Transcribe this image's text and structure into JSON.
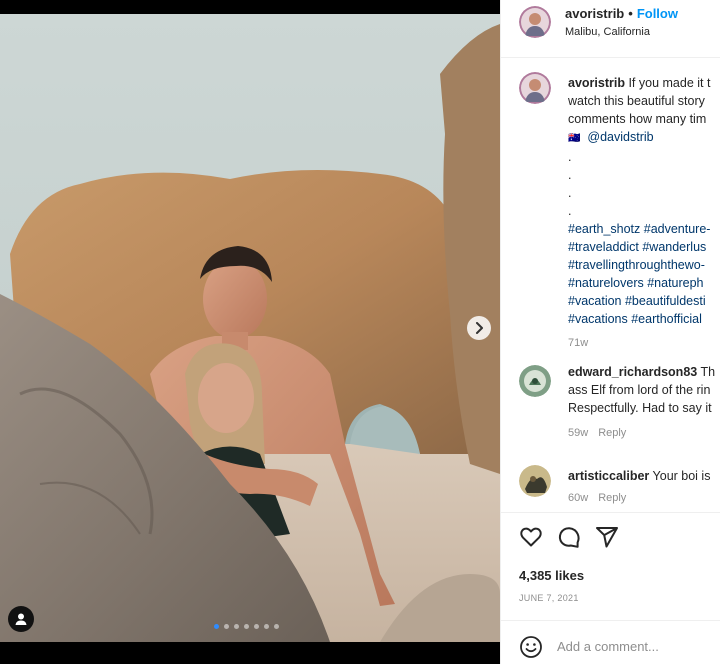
{
  "post": {
    "photo_alt": "Couple posing between rocks on a beach",
    "carousel": {
      "count": 7,
      "active_index": 0
    }
  },
  "header": {
    "username": "avoristrib",
    "separator": "•",
    "follow_label": "Follow",
    "location": "Malibu, California"
  },
  "caption": {
    "username": "avoristrib",
    "lines": [
      "If you made it t",
      "watch this beautiful story",
      "comments how many tim"
    ],
    "flag": "🇦🇺",
    "mention": "@davidstrib",
    "dots": [
      ".",
      ".",
      ".",
      "."
    ],
    "hashtag_lines": [
      "#earth_shotz #adventure-",
      "#traveladdict #wanderlus",
      "#travellingthroughthewo-",
      "#naturelovers #natureph",
      "#vacation #beautifuldesti",
      "#vacations #earthofficial"
    ],
    "age": "71w"
  },
  "comments": [
    {
      "username": "edward_richardson83",
      "text_first": "Th",
      "lines": [
        "ass Elf from lord of the rin",
        "Respectfully. Had to say it"
      ],
      "age": "59w",
      "reply_label": "Reply"
    },
    {
      "username": "artisticcaliber",
      "text_first": "Your boi is",
      "lines": [],
      "age": "60w",
      "reply_label": "Reply"
    }
  ],
  "actions": {
    "icons": [
      "heart-icon",
      "comment-icon",
      "share-icon"
    ],
    "likes": "4,385 likes",
    "date": "JUNE 7, 2021"
  },
  "add_comment": {
    "placeholder": "Add a comment..."
  },
  "colors": {
    "link_blue": "#0095f6",
    "hashtag": "#00376b",
    "muted": "#8e8e8e"
  }
}
